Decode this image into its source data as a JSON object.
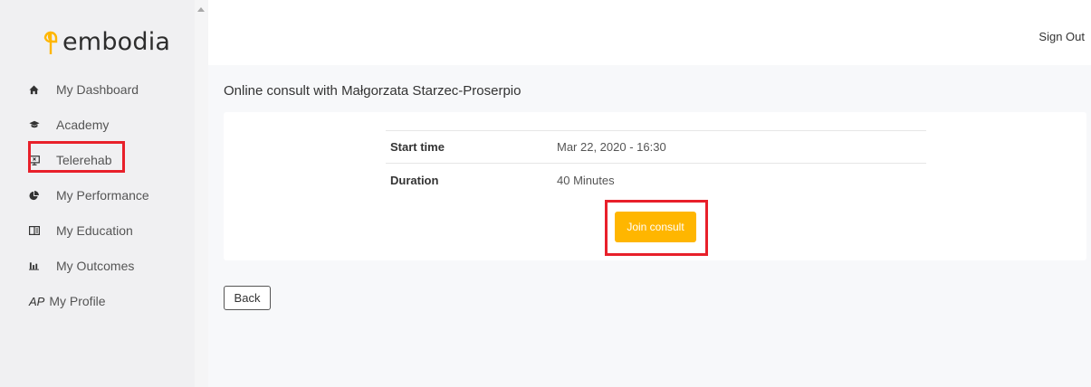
{
  "app": {
    "brand": "embodia",
    "accent_color": "#ffb600",
    "highlight_color": "#e8202a"
  },
  "header": {
    "signout_label": "Sign Out"
  },
  "sidebar": {
    "items": [
      {
        "label": "My Dashboard",
        "icon": "home-icon"
      },
      {
        "label": "Academy",
        "icon": "graduation-cap-icon"
      },
      {
        "label": "Telerehab",
        "icon": "monitor-icon"
      },
      {
        "label": "My Performance",
        "icon": "pie-chart-icon"
      },
      {
        "label": "My Education",
        "icon": "book-open-icon"
      },
      {
        "label": "My Outcomes",
        "icon": "bar-chart-icon"
      },
      {
        "label": "My Profile",
        "icon": "avatar-initials",
        "icon_text": "AP"
      }
    ]
  },
  "main": {
    "title": "Online consult with Małgorzata Starzec-Proserpio",
    "details": [
      {
        "label": "Start time",
        "value": "Mar 22, 2020 - 16:30"
      },
      {
        "label": "Duration",
        "value": "40 Minutes"
      }
    ],
    "join_label": "Join consult",
    "back_label": "Back"
  }
}
